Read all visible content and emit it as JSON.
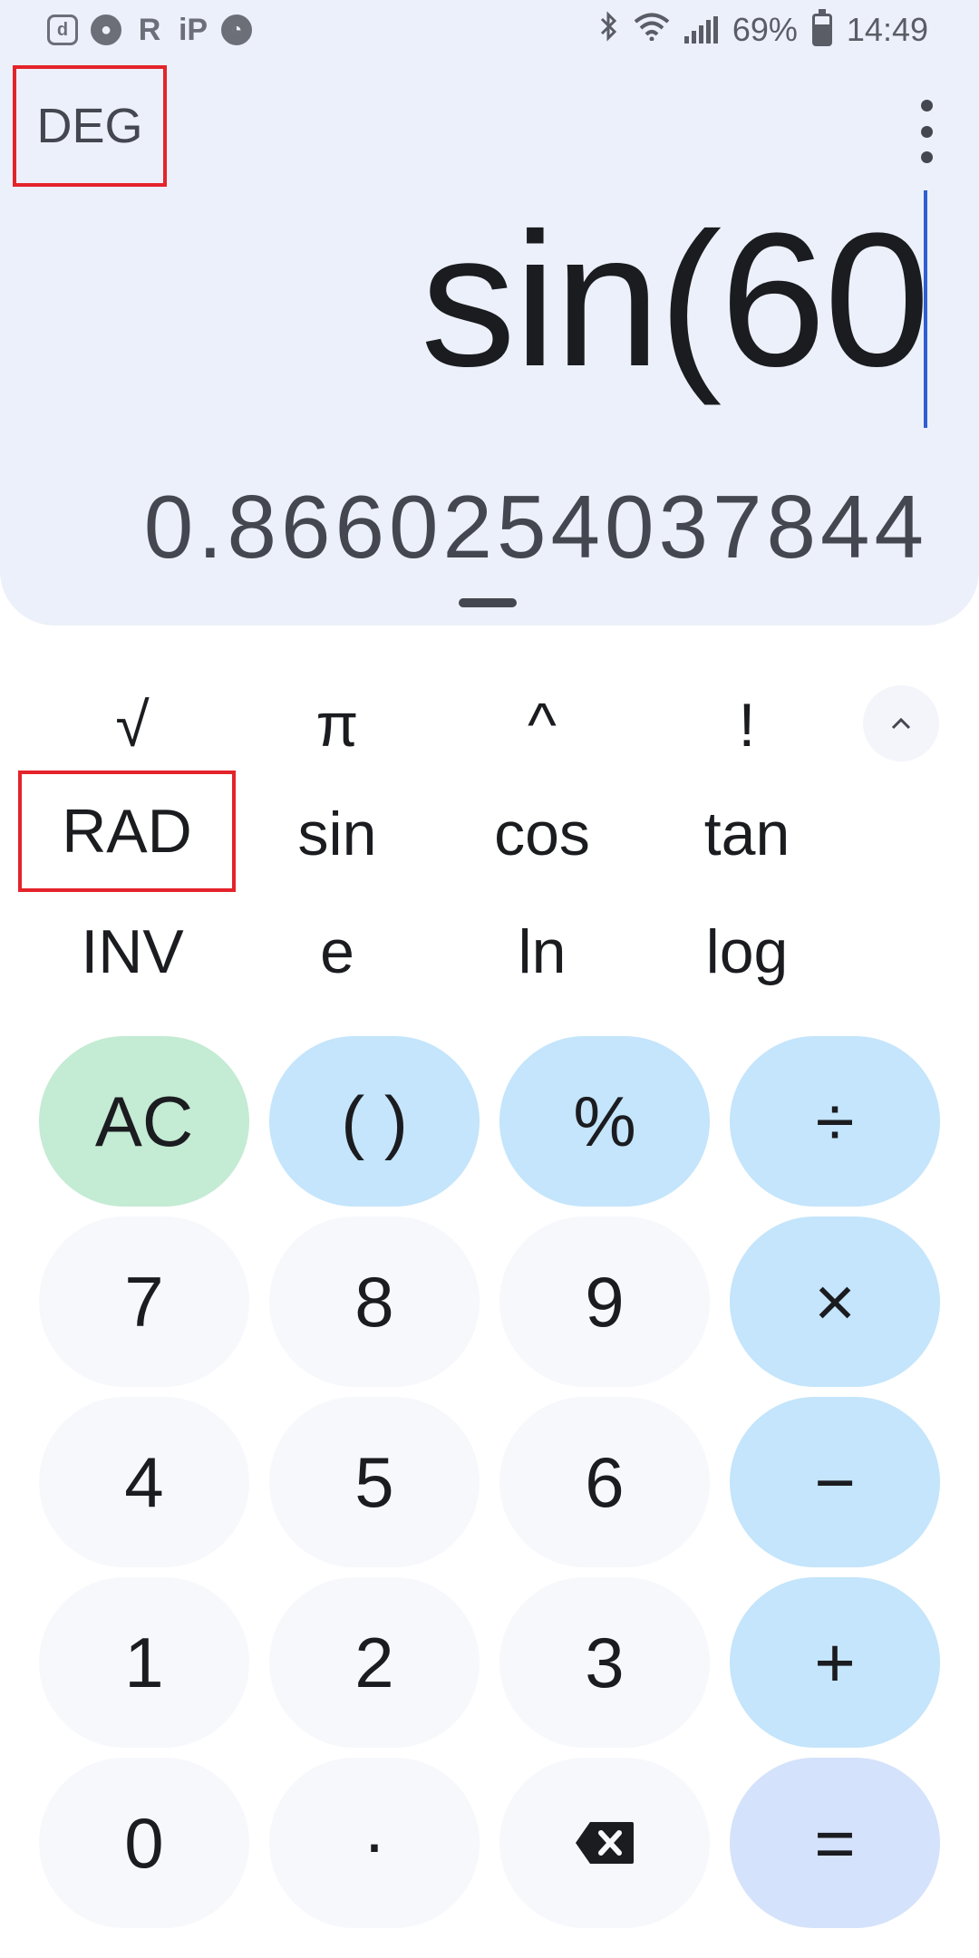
{
  "status_bar": {
    "notification_icons": [
      "d",
      "R",
      "iP"
    ],
    "battery": "69%",
    "time": "14:49"
  },
  "display": {
    "angle_mode": "DEG",
    "expression": "sin(60",
    "result": "0.8660254037844"
  },
  "scientific": {
    "row1": [
      "√",
      "π",
      "^",
      "!"
    ],
    "row2": [
      "RAD",
      "sin",
      "cos",
      "tan"
    ],
    "row3": [
      "INV",
      "e",
      "ln",
      "log"
    ],
    "collapse_icon": "chevron-up-icon"
  },
  "keypad": {
    "row1": [
      "AC",
      "( )",
      "%",
      "÷"
    ],
    "row2": [
      "7",
      "8",
      "9",
      "×"
    ],
    "row3": [
      "4",
      "5",
      "6",
      "−"
    ],
    "row4": [
      "1",
      "2",
      "3",
      "+"
    ],
    "row5": [
      "0",
      "·",
      "backspace-icon",
      "="
    ]
  },
  "colors": {
    "display_bg": "#ecf0fa",
    "number_key": "#f7f8fc",
    "operator_key": "#c4e5fb",
    "clear_key": "#c4ebd3",
    "equals_key": "#d4e2fb",
    "highlight_box": "#e4232b",
    "cursor": "#2f5fd0"
  }
}
